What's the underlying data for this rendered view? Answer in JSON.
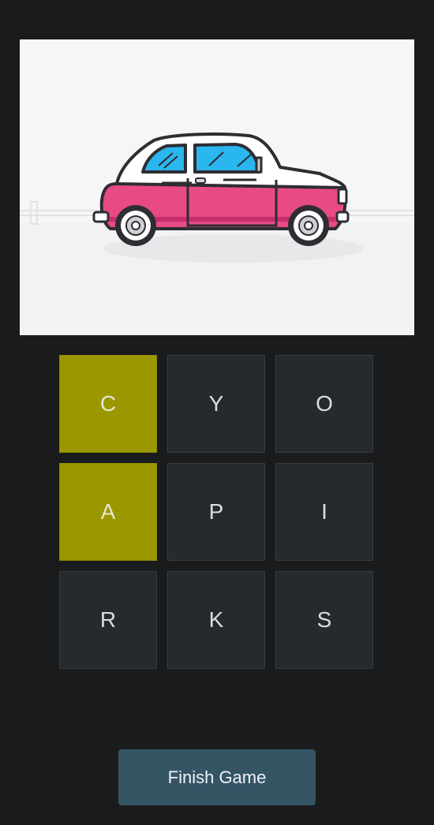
{
  "puzzle": {
    "image_subject": "car-icon",
    "letters": [
      {
        "letter": "C",
        "selected": true
      },
      {
        "letter": "Y",
        "selected": false
      },
      {
        "letter": "O",
        "selected": false
      },
      {
        "letter": "A",
        "selected": true
      },
      {
        "letter": "P",
        "selected": false
      },
      {
        "letter": "I",
        "selected": false
      },
      {
        "letter": "R",
        "selected": false
      },
      {
        "letter": "K",
        "selected": false
      },
      {
        "letter": "S",
        "selected": false
      }
    ]
  },
  "actions": {
    "finish_label": "Finish Game"
  },
  "colors": {
    "background": "#1a1b1d",
    "tile": "#272a2d",
    "tile_selected": "#9a9700",
    "button": "#355565",
    "car_body": "#e84a86",
    "car_window": "#2ab6ef"
  }
}
